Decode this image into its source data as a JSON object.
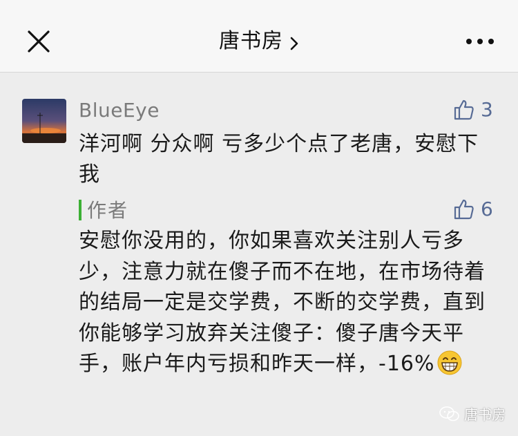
{
  "header": {
    "title": "唐书房",
    "close_icon": "close-icon",
    "chevron_icon": "chevron-right-icon",
    "more_icon": "more-icon"
  },
  "comment": {
    "username": "BlueEye",
    "likes": "3",
    "text": "洋河啊 分众啊 亏多少个点了老唐，安慰下我"
  },
  "reply": {
    "author_label": "作者",
    "likes": "6",
    "text": "安慰你没用的，你如果喜欢关注别人亏多少，注意力就在傻子而不在地，在市场待着的结局一定是交学费，不断的交学费，直到你能够学习放弃关注傻子：傻子唐今天平手，账户年内亏损和昨天一样，-16%",
    "emoji": "grinning-face"
  },
  "watermark": {
    "text": "唐书房",
    "icon": "wechat-icon"
  },
  "colors": {
    "like_blue": "#576b95",
    "author_green": "#3cb034",
    "background": "#ededed"
  }
}
